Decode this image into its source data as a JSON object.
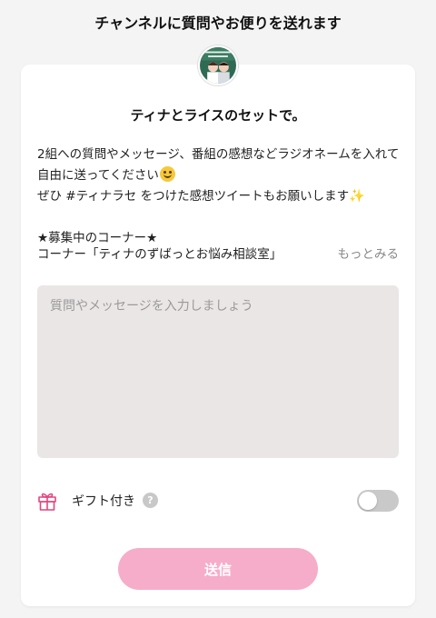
{
  "header": {
    "title": "チャンネルに質問やお便りを送れます"
  },
  "channel": {
    "title": "ティナとライスのセットで。",
    "avatar_icon": "channel-avatar-thumbnail"
  },
  "description": {
    "line1": "2組への質問やメッセージ、番組の感想などラジオネームを入れて自由に送ってください",
    "line2": "ぜひ #ティナラセ をつけた感想ツイートもお願いします",
    "recruiting_heading": "★募集中のコーナー★"
  },
  "corner": {
    "name": "コーナー「ティナのずばっとお悩み相談室」",
    "more_label": "もっとみる"
  },
  "message": {
    "placeholder": "質問やメッセージを入力しましょう",
    "value": ""
  },
  "gift": {
    "label": "ギフト付き",
    "help_symbol": "?",
    "toggle_on": false,
    "icon": "gift-icon"
  },
  "send": {
    "label": "送信"
  },
  "colors": {
    "accent_pink": "#f6adc9",
    "gift_icon_pink": "#e0467f",
    "textarea_bg": "#ebe6e6",
    "toggle_off": "#c9c9c9"
  }
}
